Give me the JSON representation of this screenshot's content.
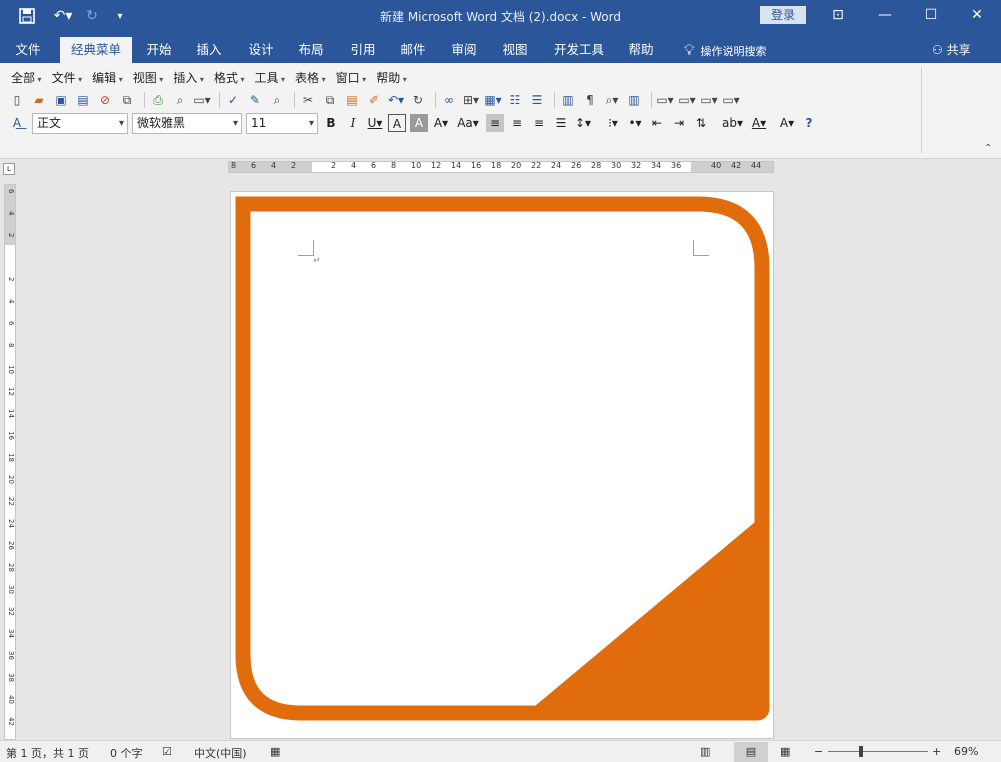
{
  "titlebar": {
    "title": "新建 Microsoft Word 文档 (2).docx  -  Word",
    "login": "登录"
  },
  "tabs": [
    "文件",
    "经典菜单",
    "开始",
    "插入",
    "设计",
    "布局",
    "引用",
    "邮件",
    "审阅",
    "视图",
    "开发工具",
    "帮助"
  ],
  "active_tab": "经典菜单",
  "tellme": "操作说明搜索",
  "share": "共享",
  "classic_menu": [
    "全部",
    "文件",
    "编辑",
    "视图",
    "插入",
    "格式",
    "工具",
    "表格",
    "窗口",
    "帮助"
  ],
  "format": {
    "style": "正文",
    "font": "微软雅黑",
    "size": "11"
  },
  "ruler_h": [
    "8",
    "6",
    "4",
    "2",
    "2",
    "4",
    "6",
    "8",
    "10",
    "12",
    "14",
    "16",
    "18",
    "20",
    "22",
    "24",
    "26",
    "28",
    "30",
    "32",
    "34",
    "36",
    "40",
    "42",
    "44"
  ],
  "ruler_v": [
    "6",
    "4",
    "2",
    "2",
    "4",
    "6",
    "8",
    "10",
    "12",
    "14",
    "16",
    "18",
    "20",
    "22",
    "24",
    "26",
    "28",
    "30",
    "32",
    "34",
    "36",
    "38",
    "40",
    "42"
  ],
  "statusbar": {
    "page": "第 1 页，共 1 页",
    "words": "0 个字",
    "language": "中文(中国)",
    "zoom": "69%"
  },
  "colors": {
    "title_blue": "#2b579a",
    "shape_orange": "#e06c0c"
  }
}
